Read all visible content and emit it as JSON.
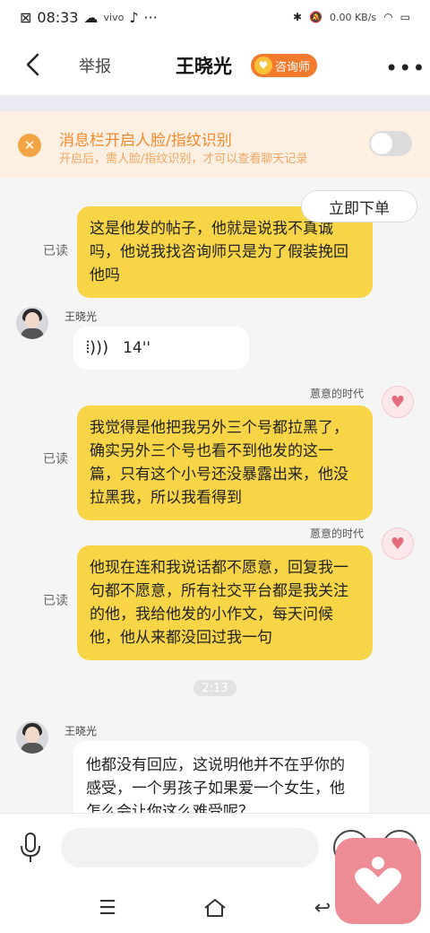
{
  "status_bar": {
    "time": "08:33",
    "net_speed": "0.00",
    "net_unit": "KB/s"
  },
  "nav": {
    "report_label": "举报",
    "title": "王晓光",
    "badge_label": "咨询师",
    "more_label": "•••"
  },
  "notice": {
    "title": "消息栏开启人脸/指纹识别",
    "subtitle": "开启后，需人脸/指纹识别，才可以查看聊天记录",
    "toggle_on": false
  },
  "order_button": "立即下单",
  "messages": [
    {
      "side": "right",
      "text": "这是他发的帖子，他就是说我不真诚吗，他说我找咨询师只是为了假装挽回他吗",
      "status": "已读"
    },
    {
      "side": "left",
      "sender": "王晓光",
      "type": "voice",
      "duration": "14''"
    },
    {
      "side": "right",
      "sender": "蒽意的时代",
      "text": "我觉得是他把我另外三个号都拉黑了，确实另外三个号也看不到他发的这一篇，只有这个小号还没暴露出来，他没拉黑我，所以我看得到",
      "status": "已读"
    },
    {
      "side": "right",
      "sender": "蒽意的时代",
      "text": "他现在连和我说话都不愿意，回复我一句都不愿意，所有社交平台都是我关注的他，我给他发的小作文，每天问候他，他从来都没回过我一句",
      "status": "已读"
    },
    {
      "side": "left",
      "sender": "王晓光",
      "text": "他都没有回应，这说明他并不在乎你的感受，一个男孩子如果爱一个女生，他怎么会让你这么难受呢？"
    }
  ],
  "time_divider": "2:13",
  "input": {
    "placeholder": ""
  },
  "colors": {
    "bubble_self": "#f7d547",
    "bubble_other": "#ffffff",
    "notice_accent": "#f08a2c",
    "badge": "#f27a2c",
    "float_app": "#ef8d97"
  }
}
